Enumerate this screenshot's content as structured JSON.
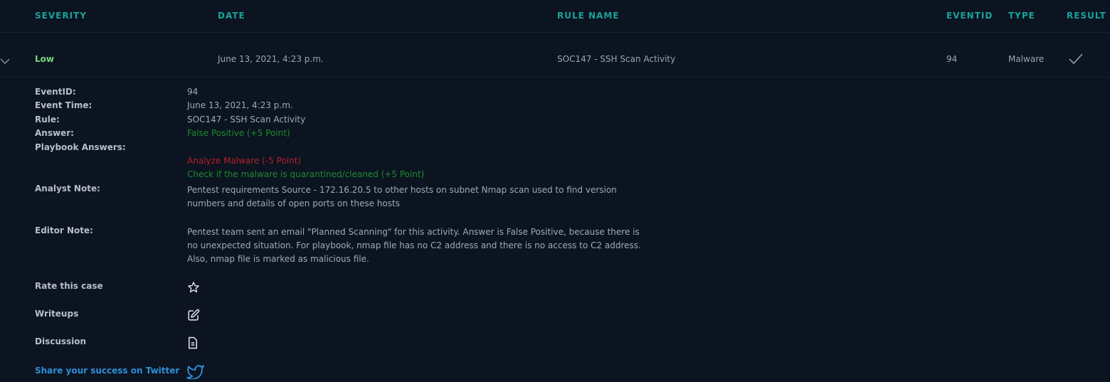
{
  "table": {
    "headers": {
      "severity": "SEVERITY",
      "date": "DATE",
      "rule_name": "RULE NAME",
      "eventid": "EVENTID",
      "type": "TYPE",
      "result": "RESULT"
    },
    "row": {
      "severity": "Low",
      "date": "June 13, 2021, 4:23 p.m.",
      "rule_name": "SOC147 - SSH Scan Activity",
      "eventid": "94",
      "type": "Malware"
    }
  },
  "details": {
    "eventid_label": "EventID:",
    "eventid_value": "94",
    "event_time_label": "Event Time:",
    "event_time_value": "June 13, 2021, 4:23 p.m.",
    "rule_label": "Rule:",
    "rule_value": "SOC147 - SSH Scan Activity",
    "answer_label": "Answer:",
    "answer_value": "False Positive (+5 Point)",
    "playbook_label": "Playbook Answers:",
    "playbook_answers": [
      "Analyze Malware (-5 Point)",
      "Check if the malware is quarantined/cleaned (+5 Point)"
    ],
    "analyst_note_label": "Analyst Note:",
    "analyst_note": "Pentest requirements Source - 172.16.20.5 to other hosts on subnet Nmap scan used to find version numbers and details of open ports on these hosts",
    "editor_note_label": "Editor Note:",
    "editor_note": "Pentest team sent an email \"Planned Scanning\" for this activity. Answer is False Positive, because there is no unexpected situation. For playbook, nmap file has no C2 address and there is no access to C2 address. Also, nmap file is marked as malicious file.",
    "rate_label": "Rate this case",
    "writeups_label": "Writeups",
    "discussion_label": "Discussion",
    "share_label": "Share your success on Twitter"
  },
  "colors": {
    "background": "#0b1420",
    "header_accent": "#1aa39a",
    "severity_low": "#7cd67c",
    "positive": "#1e8a2f",
    "negative": "#b3202a",
    "twitter": "#2f8fd8"
  },
  "icons": {
    "expand": "chevron-down-icon",
    "result": "checkmark-icon",
    "rate": "star-icon",
    "writeups": "edit-icon",
    "discussion": "document-icon",
    "share": "twitter-icon"
  }
}
